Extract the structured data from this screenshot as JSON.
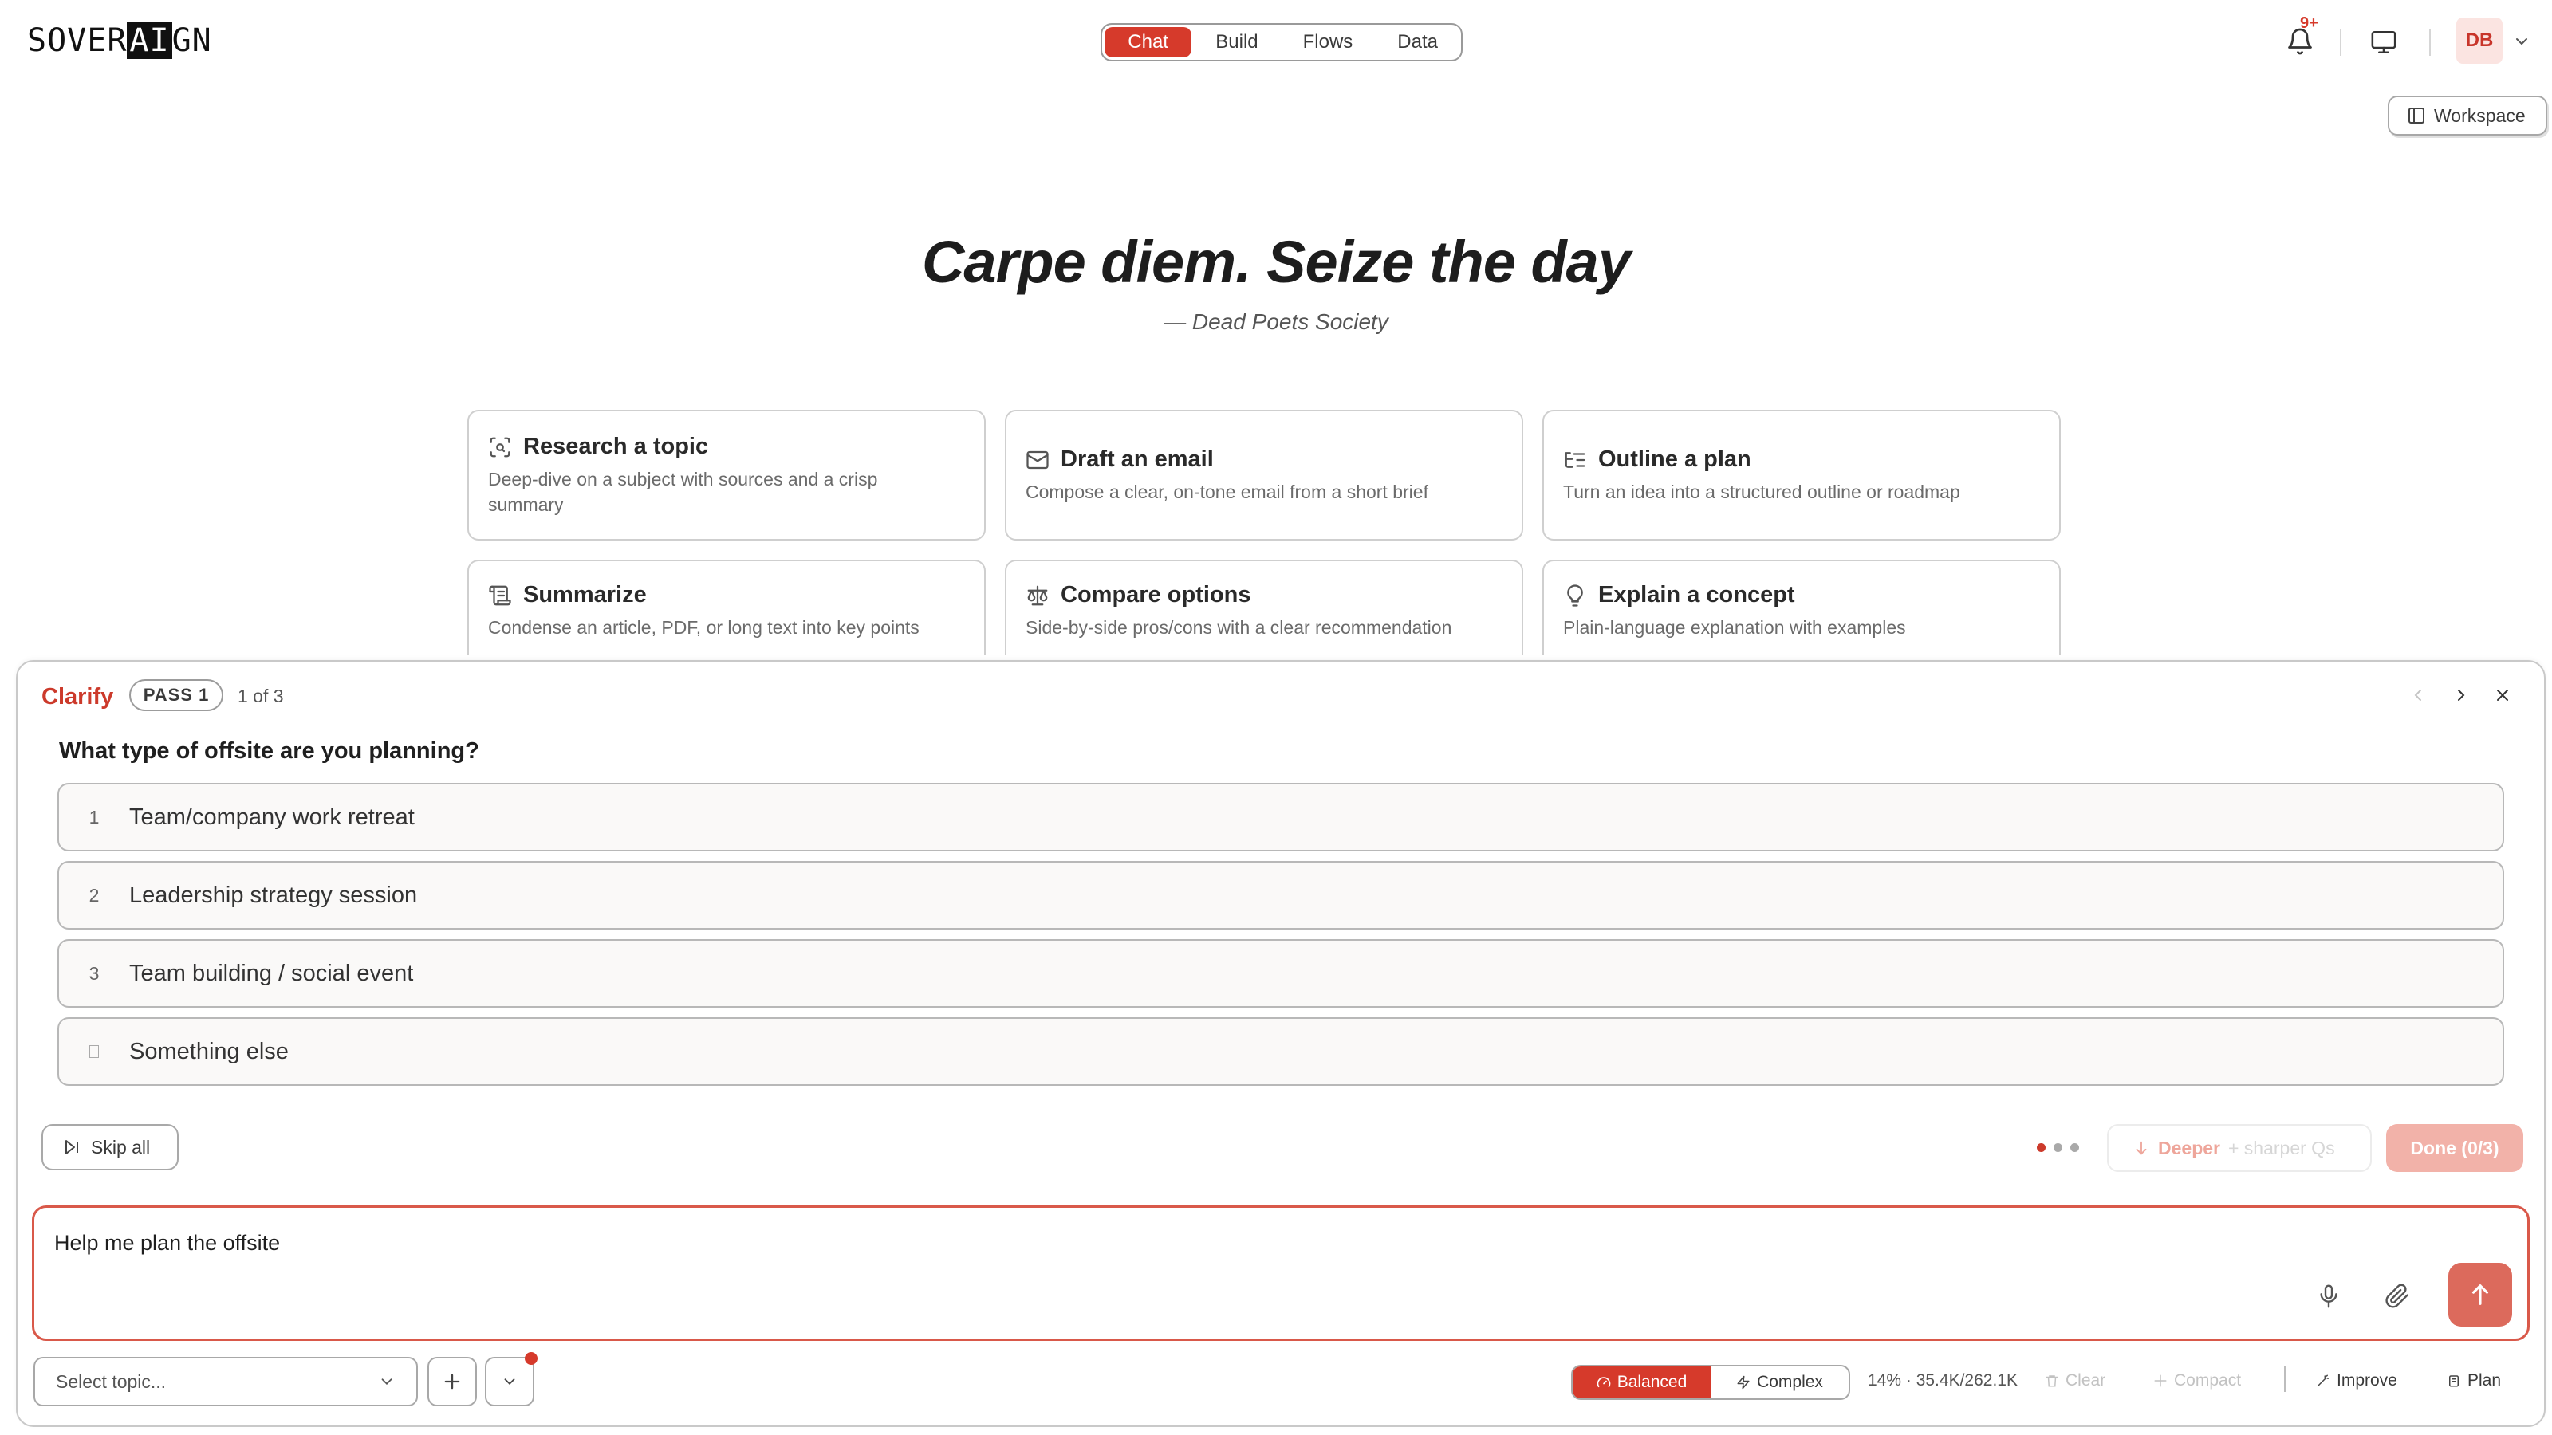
{
  "app": {
    "logo_text_1": "SOVER",
    "logo_text_ai": "AI",
    "logo_text_2": "GN"
  },
  "header": {
    "tabs": [
      {
        "label": "Chat",
        "active": true
      },
      {
        "label": "Build",
        "active": false
      },
      {
        "label": "Flows",
        "active": false
      },
      {
        "label": "Data",
        "active": false
      }
    ],
    "notification_badge": "9+",
    "notification_icon": "bell-icon",
    "display_icon": "monitor-icon",
    "avatar_initials": "DB",
    "workspace_label": "Workspace"
  },
  "hero": {
    "quote": "Carpe diem. Seize the day",
    "attribution": "— Dead Poets Society"
  },
  "cards": [
    {
      "title": "Research a topic",
      "description": "Deep-dive on a subject with sources and a crisp summary",
      "icon": "scan-search-icon"
    },
    {
      "title": "Draft an email",
      "description": "Compose a clear, on-tone email from a short brief",
      "icon": "mail-icon"
    },
    {
      "title": "Outline a plan",
      "description": "Turn an idea into a structured outline or roadmap",
      "icon": "list-tree-icon"
    },
    {
      "title": "Summarize",
      "description": "Condense an article, PDF, or long text into key points",
      "icon": "scroll-icon"
    },
    {
      "title": "Compare options",
      "description": "Side-by-side pros/cons with a clear recommendation",
      "icon": "scale-icon"
    },
    {
      "title": "Explain a concept",
      "description": "Plain-language explanation with examples",
      "icon": "lightbulb-icon"
    }
  ],
  "clarify": {
    "label": "Clarify",
    "pass_badge": "PASS 1",
    "pass_count": "1 of 3",
    "question": "What type of offsite are you planning?",
    "options": [
      {
        "number": "1",
        "label": "Team/company work retreat"
      },
      {
        "number": "2",
        "label": "Leadership strategy session"
      },
      {
        "number": "3",
        "label": "Team building / social event"
      },
      {
        "number": "",
        "label": "Something else"
      }
    ],
    "skip_label": "Skip all",
    "deeper_label": "Deeper",
    "deeper_hint": "+ sharper Qs",
    "done_label": "Done (0/3)",
    "progress_dots_active": 1,
    "progress_dots_total": 3
  },
  "composer": {
    "text": "Help me plan the offsite"
  },
  "footer": {
    "topic_placeholder": "Select topic...",
    "modes": [
      {
        "label": "Balanced",
        "active": true,
        "icon": "gauge-icon"
      },
      {
        "label": "Complex",
        "active": false,
        "icon": "zap-icon"
      }
    ],
    "context_usage": "14% · 35.4K/262.1K",
    "clear_label": "Clear",
    "compact_label": "Compact",
    "improve_label": "Improve",
    "plan_label": "Plan"
  },
  "colors": {
    "accent": "#d63a2b",
    "accent_soft": "#f2b2a9",
    "border": "#cfcfcf"
  }
}
